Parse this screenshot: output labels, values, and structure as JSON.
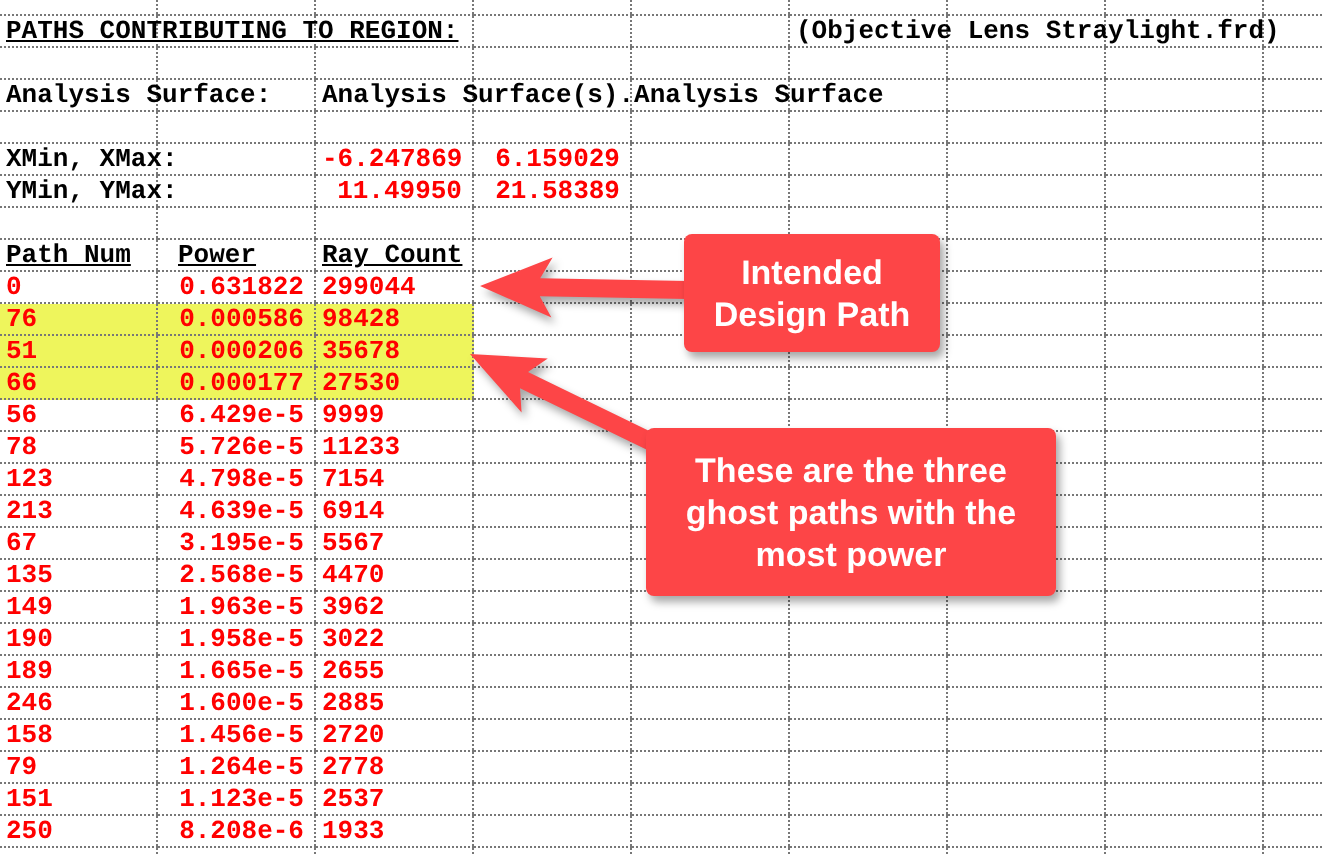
{
  "title": "PATHS CONTRIBUTING TO REGION:",
  "file": "(Objective Lens Straylight.frd)",
  "analysis_surface": {
    "label": "Analysis Surface:",
    "value": "Analysis Surface(s).Analysis Surface"
  },
  "x_range": {
    "label": "XMin, XMax:",
    "min": "-6.247869",
    "max": "6.159029"
  },
  "y_range": {
    "label": "YMin, YMax:",
    "min": "11.49950",
    "max": "21.58389"
  },
  "columns": [
    "Path Num",
    "Power",
    "Ray Count"
  ],
  "rows": [
    {
      "path": "0",
      "power": "0.631822",
      "ray_count": "299044",
      "highlighted": false
    },
    {
      "path": "76",
      "power": "0.000586",
      "ray_count": "98428",
      "highlighted": true
    },
    {
      "path": "51",
      "power": "0.000206",
      "ray_count": "35678",
      "highlighted": true
    },
    {
      "path": "66",
      "power": "0.000177",
      "ray_count": "27530",
      "highlighted": true
    },
    {
      "path": "56",
      "power": "6.429e-5",
      "ray_count": "9999",
      "highlighted": false
    },
    {
      "path": "78",
      "power": "5.726e-5",
      "ray_count": "11233",
      "highlighted": false
    },
    {
      "path": "123",
      "power": "4.798e-5",
      "ray_count": "7154",
      "highlighted": false
    },
    {
      "path": "213",
      "power": "4.639e-5",
      "ray_count": "6914",
      "highlighted": false
    },
    {
      "path": "67",
      "power": "3.195e-5",
      "ray_count": "5567",
      "highlighted": false
    },
    {
      "path": "135",
      "power": "2.568e-5",
      "ray_count": "4470",
      "highlighted": false
    },
    {
      "path": "149",
      "power": "1.963e-5",
      "ray_count": "3962",
      "highlighted": false
    },
    {
      "path": "190",
      "power": "1.958e-5",
      "ray_count": "3022",
      "highlighted": false
    },
    {
      "path": "189",
      "power": "1.665e-5",
      "ray_count": "2655",
      "highlighted": false
    },
    {
      "path": "246",
      "power": "1.600e-5",
      "ray_count": "2885",
      "highlighted": false
    },
    {
      "path": "158",
      "power": "1.456e-5",
      "ray_count": "2720",
      "highlighted": false
    },
    {
      "path": "79",
      "power": "1.264e-5",
      "ray_count": "2778",
      "highlighted": false
    },
    {
      "path": "151",
      "power": "1.123e-5",
      "ray_count": "2537",
      "highlighted": false
    },
    {
      "path": "250",
      "power": "8.208e-6",
      "ray_count": "1933",
      "highlighted": false
    }
  ],
  "callouts": [
    {
      "text": "Intended Design Path"
    },
    {
      "text": "These are the three ghost paths with the most power"
    }
  ]
}
